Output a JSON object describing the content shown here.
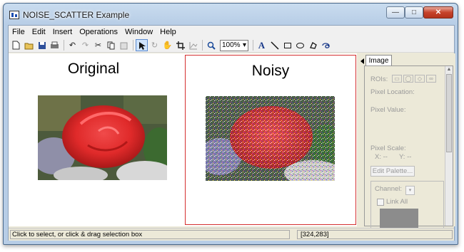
{
  "window": {
    "title": "NOISE_SCATTER Example",
    "minimize_glyph": "—",
    "maximize_glyph": "□",
    "close_glyph": "✕"
  },
  "menu": [
    "File",
    "Edit",
    "Insert",
    "Operations",
    "Window",
    "Help"
  ],
  "toolbar": {
    "zoom_value": "100%",
    "text_tool_glyph": "A",
    "icons": [
      "new-file-icon",
      "open-folder-icon",
      "save-icon",
      "print-icon",
      "undo-icon",
      "redo-icon",
      "cut-icon",
      "copy-icon",
      "paste-icon",
      "select-arrow-icon",
      "rotate-icon",
      "pan-hand-icon",
      "crop-icon",
      "plot-icon",
      "zoom-icon",
      "text-icon",
      "line-icon",
      "rectangle-icon",
      "ellipse-icon",
      "freehand-roi-icon",
      "polygon-icon"
    ]
  },
  "canvas": {
    "original_title": "Original",
    "noisy_title": "Noisy",
    "selection_color": "#d43030"
  },
  "side_panel": {
    "tab_label": "Image",
    "rois_label": "ROIs:",
    "pixel_location_label": "Pixel Location:",
    "pixel_value_label": "Pixel Value:",
    "pixel_scale_label": "Pixel Scale:",
    "x_readout": "X: --",
    "y_readout": "Y: --",
    "edit_palette_label": "Edit Palette...",
    "channel_label": "Channel:",
    "link_all_label": "Link All"
  },
  "status": {
    "hint": "Click to select, or click & drag selection box",
    "coords": "[324,283]"
  }
}
